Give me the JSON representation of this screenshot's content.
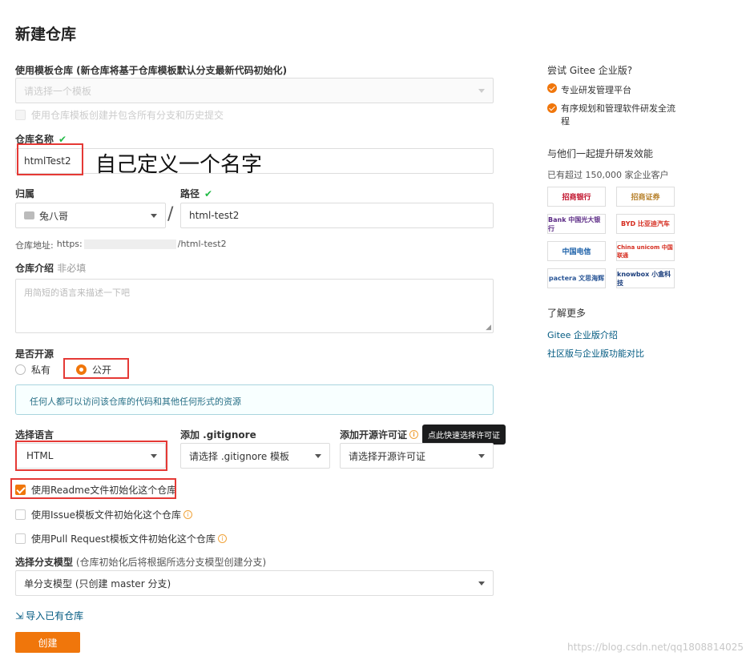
{
  "page": {
    "title": "新建仓库"
  },
  "template": {
    "label": "使用模板仓库 (新仓库将基于仓库模板默认分支最新代码初始化)",
    "placeholder": "请选择一个模板",
    "checkbox_label": "使用仓库模板创建并包含所有分支和历史提交"
  },
  "repo_name": {
    "label": "仓库名称",
    "check": "✔",
    "value": "htmlTest2",
    "annotation": "自己定义一个名字"
  },
  "owner": {
    "label": "归属",
    "value": "兔八哥",
    "separator": "/"
  },
  "path": {
    "label": "路径",
    "check": "✔",
    "value": "html-test2"
  },
  "address": {
    "label": "仓库地址:",
    "prefix": "https:",
    "suffix": "/html-test2"
  },
  "intro": {
    "label": "仓库介绍",
    "optional": "非必填",
    "placeholder": "用简短的语言来描述一下吧"
  },
  "open_source": {
    "label": "是否开源",
    "private_label": "私有",
    "public_label": "公开",
    "notice": "任何人都可以访问该仓库的代码和其他任何形式的资源"
  },
  "language": {
    "label": "选择语言",
    "value": "HTML"
  },
  "gitignore": {
    "label": "添加 .gitignore",
    "value": "请选择 .gitignore 模板"
  },
  "license": {
    "label": "添加开源许可证",
    "value": "请选择开源许可证",
    "tooltip": "点此快速选择许可证",
    "info": "i"
  },
  "init": {
    "readme": "使用Readme文件初始化这个仓库",
    "issue": "使用Issue模板文件初始化这个仓库",
    "pr": "使用Pull Request模板文件初始化这个仓库"
  },
  "branch": {
    "label": "选择分支模型",
    "hint": "(仓库初始化后将根据所选分支模型创建分支)",
    "value": "单分支模型 (只创建 master 分支)"
  },
  "import_link": "导入已有仓库",
  "create_button": "创建",
  "sidebar": {
    "try_title": "尝试 Gitee 企业版?",
    "features": [
      "专业研发管理平台",
      "有序规划和管理软件研发全流程"
    ],
    "together_title": "与他们一起提升研发效能",
    "customers": "已有超过 150,000 家企业客户",
    "logos": [
      "招商银行",
      "招商证券",
      "Bank 中国光大银行",
      "BYD 比亚迪汽车",
      "中国电信",
      "China unicom 中国联通",
      "pactera 文思海辉",
      "knowbox 小盒科技"
    ],
    "learn_title": "了解更多",
    "links": [
      "Gitee 企业版介绍",
      "社区版与企业版功能对比"
    ]
  },
  "watermark": "https://blog.csdn.net/qq1808814025",
  "colors": {
    "accent": "#f0760b",
    "success": "#21ba45",
    "annotation_border": "#e53935"
  }
}
